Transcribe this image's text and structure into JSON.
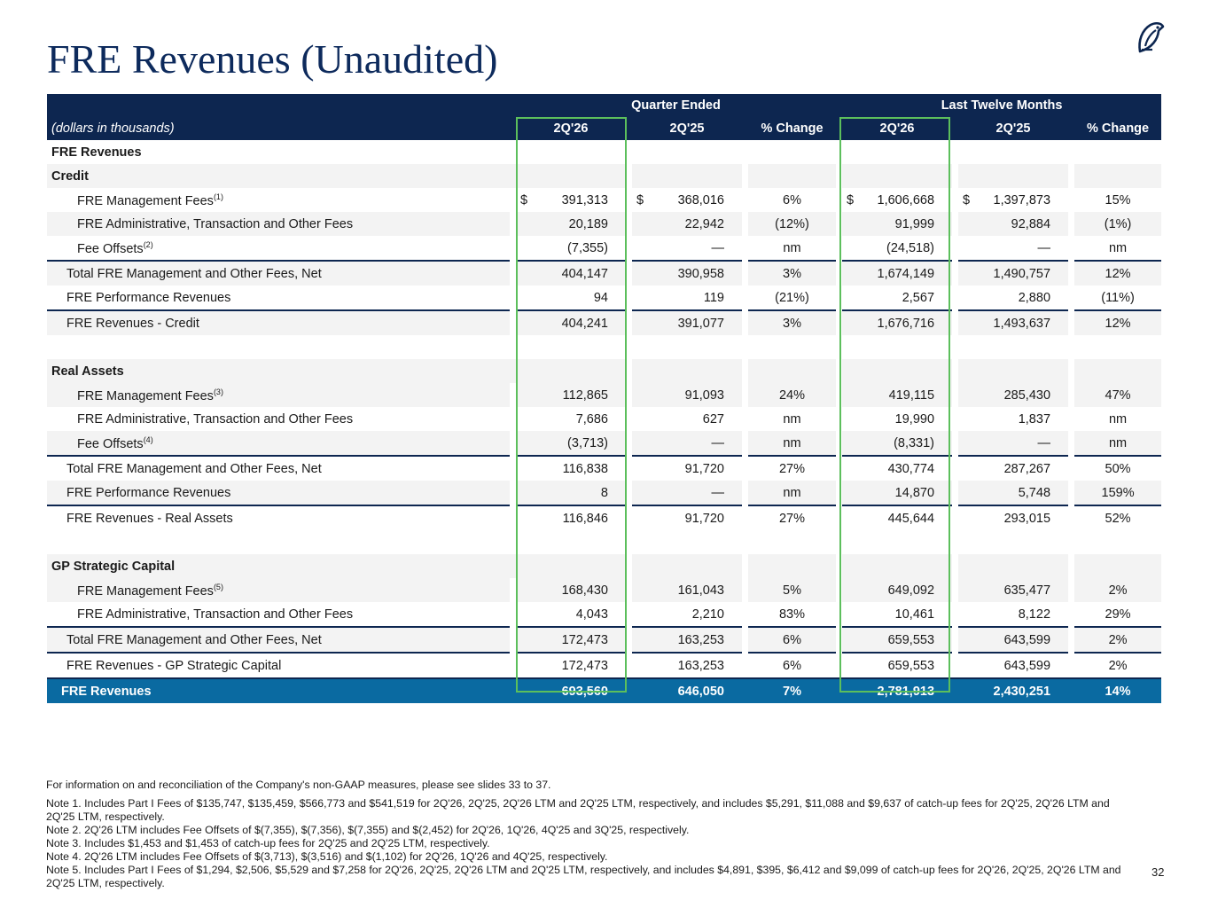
{
  "title": "FRE Revenues (Unaudited)",
  "page_number": "32",
  "header": {
    "group_quarter": "Quarter Ended",
    "group_ltm": "Last Twelve Months",
    "units": "(dollars in thousands)",
    "columns": [
      "2Q'26",
      "2Q'25",
      "% Change",
      "2Q'26",
      "2Q'25",
      "% Change"
    ]
  },
  "sections": {
    "fre_revenues_heading": "FRE Revenues",
    "credit": {
      "heading": "Credit",
      "rows": [
        {
          "label": "FRE Management Fees",
          "sup": "(1)",
          "dollar": "$",
          "q26": "391,313",
          "q25": "368,016",
          "qchg": "6%",
          "l26": "1,606,668",
          "l25": "1,397,873",
          "lchg": "15%"
        },
        {
          "label": "FRE Administrative, Transaction and Other Fees",
          "q26": "20,189",
          "q25": "22,942",
          "qchg": "(12%)",
          "l26": "91,999",
          "l25": "92,884",
          "lchg": "(1%)"
        },
        {
          "label": "Fee Offsets",
          "sup": "(2)",
          "q26": "(7,355)",
          "q25": "—",
          "qchg": "nm",
          "l26": "(24,518)",
          "l25": "—",
          "lchg": "nm"
        },
        {
          "label": "Total FRE Management and Other Fees, Net",
          "q26": "404,147",
          "q25": "390,958",
          "qchg": "3%",
          "l26": "1,674,149",
          "l25": "1,490,757",
          "lchg": "12%"
        },
        {
          "label": "FRE Performance Revenues",
          "q26": "94",
          "q25": "119",
          "qchg": "(21%)",
          "l26": "2,567",
          "l25": "2,880",
          "lchg": "(11%)"
        },
        {
          "label": "FRE Revenues - Credit",
          "q26": "404,241",
          "q25": "391,077",
          "qchg": "3%",
          "l26": "1,676,716",
          "l25": "1,493,637",
          "lchg": "12%"
        }
      ]
    },
    "real_assets": {
      "heading": "Real Assets",
      "rows": [
        {
          "label": "FRE Management Fees",
          "sup": "(3)",
          "q26": "112,865",
          "q25": "91,093",
          "qchg": "24%",
          "l26": "419,115",
          "l25": "285,430",
          "lchg": "47%"
        },
        {
          "label": "FRE Administrative, Transaction and Other Fees",
          "q26": "7,686",
          "q25": "627",
          "qchg": "nm",
          "l26": "19,990",
          "l25": "1,837",
          "lchg": "nm"
        },
        {
          "label": "Fee Offsets",
          "sup": "(4)",
          "q26": "(3,713)",
          "q25": "—",
          "qchg": "nm",
          "l26": "(8,331)",
          "l25": "—",
          "lchg": "nm"
        },
        {
          "label": "Total FRE Management and Other Fees, Net",
          "q26": "116,838",
          "q25": "91,720",
          "qchg": "27%",
          "l26": "430,774",
          "l25": "287,267",
          "lchg": "50%"
        },
        {
          "label": "FRE Performance Revenues",
          "q26": "8",
          "q25": "—",
          "qchg": "nm",
          "l26": "14,870",
          "l25": "5,748",
          "lchg": "159%"
        },
        {
          "label": "FRE Revenues - Real Assets",
          "q26": "116,846",
          "q25": "91,720",
          "qchg": "27%",
          "l26": "445,644",
          "l25": "293,015",
          "lchg": "52%"
        }
      ]
    },
    "gp_strategic": {
      "heading": "GP Strategic Capital",
      "rows": [
        {
          "label": "FRE Management Fees",
          "sup": "(5)",
          "q26": "168,430",
          "q25": "161,043",
          "qchg": "5%",
          "l26": "649,092",
          "l25": "635,477",
          "lchg": "2%"
        },
        {
          "label": "FRE Administrative, Transaction and Other Fees",
          "q26": "4,043",
          "q25": "2,210",
          "qchg": "83%",
          "l26": "10,461",
          "l25": "8,122",
          "lchg": "29%"
        },
        {
          "label": "Total FRE Management and Other Fees, Net",
          "q26": "172,473",
          "q25": "163,253",
          "qchg": "6%",
          "l26": "659,553",
          "l25": "643,599",
          "lchg": "2%"
        },
        {
          "label": "FRE Revenues - GP Strategic Capital",
          "q26": "172,473",
          "q25": "163,253",
          "qchg": "6%",
          "l26": "659,553",
          "l25": "643,599",
          "lchg": "2%"
        }
      ]
    },
    "total": {
      "label": "FRE Revenues",
      "q26": "693,560",
      "q25": "646,050",
      "qchg": "7%",
      "l26": "2,781,913",
      "l25": "2,430,251",
      "lchg": "14%"
    }
  },
  "footer": {
    "info": "For information on and reconciliation of the Company's non-GAAP measures, please see slides 33 to 37.",
    "notes": [
      "Note 1. Includes Part I Fees of $135,747, $135,459, $566,773 and $541,519 for 2Q'26, 2Q'25, 2Q'26 LTM and 2Q'25 LTM, respectively, and includes $5,291, $11,088 and $9,637 of catch-up fees for 2Q'25, 2Q'26 LTM and 2Q'25 LTM, respectively.",
      "Note 2. 2Q'26 LTM includes Fee Offsets of $(7,355), $(7,356), $(7,355) and $(2,452) for 2Q'26, 1Q'26, 4Q'25 and 3Q'25, respectively.",
      "Note 3. Includes $1,453 and $1,453 of catch-up fees for 2Q'25 and 2Q'25 LTM, respectively.",
      "Note 4. 2Q'26 LTM includes Fee Offsets of $(3,713), $(3,516) and $(1,102) for 2Q'26, 1Q'26 and 4Q'25, respectively.",
      "Note 5. Includes Part I Fees of $1,294, $2,506, $5,529 and $7,258 for 2Q'26, 2Q'25, 2Q'26 LTM and 2Q'25 LTM, respectively, and includes $4,891, $395, $6,412 and $9,099 of catch-up fees for 2Q'26, 2Q'25, 2Q'26 LTM and 2Q'25 LTM, respectively."
    ]
  }
}
